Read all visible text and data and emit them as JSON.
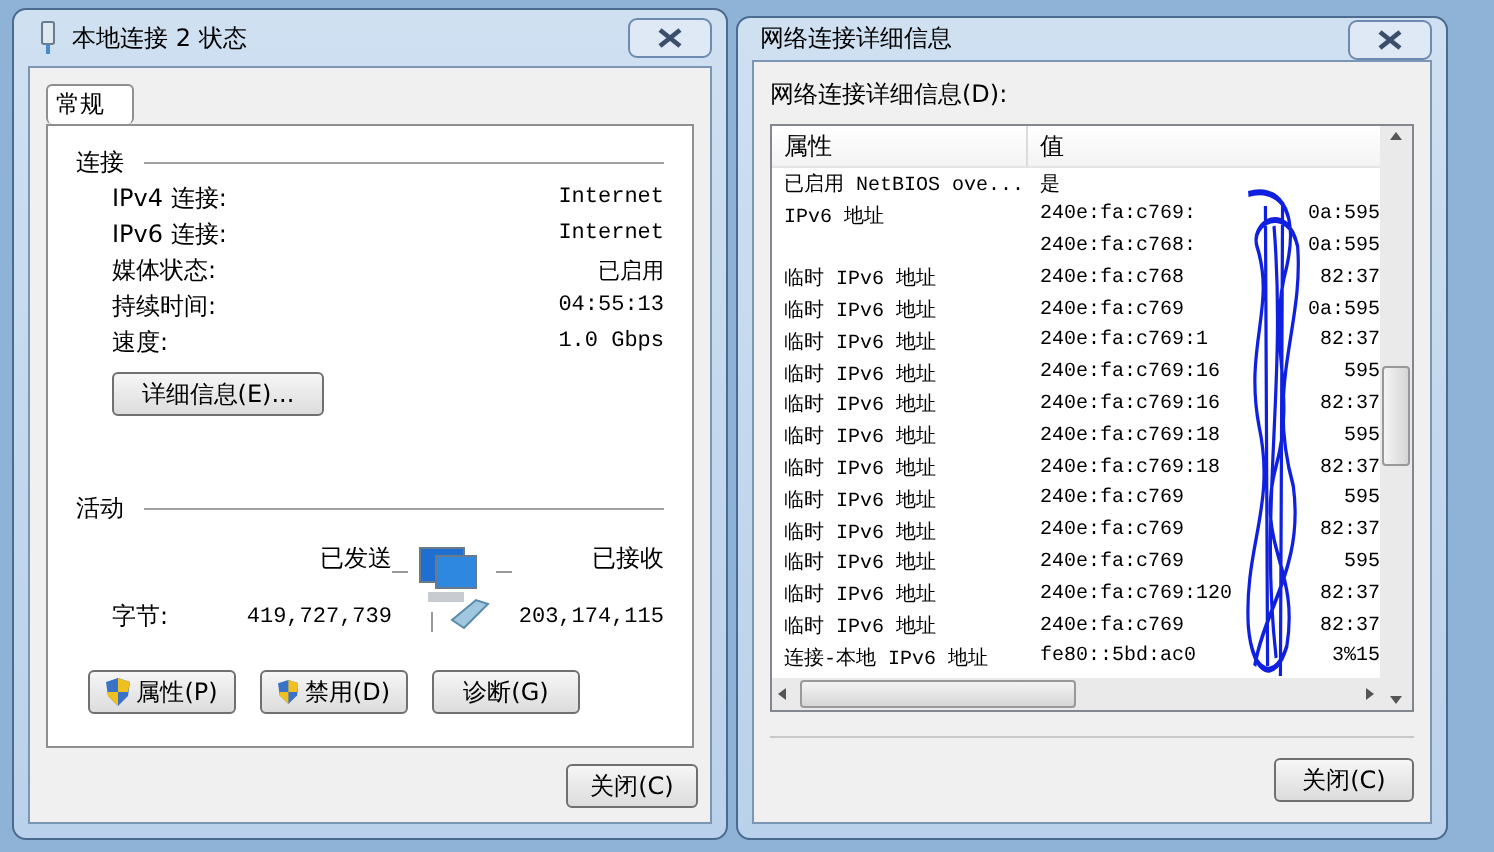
{
  "status_window": {
    "title": "本地连接 2 状态",
    "tabs": [
      {
        "label": "常规",
        "selected": true
      }
    ],
    "connection": {
      "heading": "连接",
      "fields": [
        {
          "label": "IPv4 连接:",
          "value": "Internet"
        },
        {
          "label": "IPv6 连接:",
          "value": "Internet"
        },
        {
          "label": "媒体状态:",
          "value": "已启用"
        },
        {
          "label": "持续时间:",
          "value": "04:55:13"
        },
        {
          "label": "速度:",
          "value": "1.0 Gbps"
        }
      ]
    },
    "details_button": "详细信息(E)...",
    "activity": {
      "heading": "活动",
      "sent_label": "已发送",
      "received_label": "已接收",
      "bytes_label": "字节:",
      "bytes_sent": "419,727,739",
      "bytes_received": "203,174,115"
    },
    "buttons": [
      {
        "label": "属性(P)",
        "shield": true
      },
      {
        "label": "禁用(D)",
        "shield": true
      },
      {
        "label": "诊断(G)",
        "shield": false
      }
    ],
    "close_button": "关闭(C)"
  },
  "details_window": {
    "title": "网络连接详细信息",
    "list_label": "网络连接详细信息(D):",
    "columns": [
      "属性",
      "值"
    ],
    "rows": [
      {
        "property": "已启用 NetBIOS ove...",
        "value": "是"
      },
      {
        "property": "IPv6 地址",
        "value": "240e:fa:c769:",
        "value_end": "0a:595"
      },
      {
        "value": "240e:fa:c768:",
        "value_end": "0a:595"
      },
      {
        "property": "临时 IPv6 地址",
        "value": "240e:fa:c768",
        "value_end": "82:37"
      },
      {
        "property": "临时 IPv6 地址",
        "value": "240e:fa:c769",
        "value_end": "0a:595"
      },
      {
        "property": "临时 IPv6 地址",
        "value": "240e:fa:c769:1",
        "value_end": "82:37"
      },
      {
        "property": "临时 IPv6 地址",
        "value": "240e:fa:c769:16",
        "value_end": "595"
      },
      {
        "property": "临时 IPv6 地址",
        "value": "240e:fa:c769:16",
        "value_end": "82:37"
      },
      {
        "property": "临时 IPv6 地址",
        "value": "240e:fa:c769:18",
        "value_end": "595"
      },
      {
        "property": "临时 IPv6 地址",
        "value": "240e:fa:c769:18",
        "value_end": "82:37"
      },
      {
        "property": "临时 IPv6 地址",
        "value": "240e:fa:c769",
        "value_end": "595"
      },
      {
        "property": "临时 IPv6 地址",
        "value": "240e:fa:c769",
        "value_end": "82:37"
      },
      {
        "property": "临时 IPv6 地址",
        "value": "240e:fa:c769",
        "value_end": "595"
      },
      {
        "property": "临时 IPv6 地址",
        "value": "240e:fa:c769:120",
        "value_end": "82:37"
      },
      {
        "property": "临时 IPv6 地址",
        "value": "240e:fa:c769",
        "value_end": "82:37"
      },
      {
        "property": "连接-本地 IPv6 地址",
        "value": "fe80::5bd:ac0",
        "value_end": "3%15"
      }
    ],
    "close_button": "关闭(C)"
  }
}
